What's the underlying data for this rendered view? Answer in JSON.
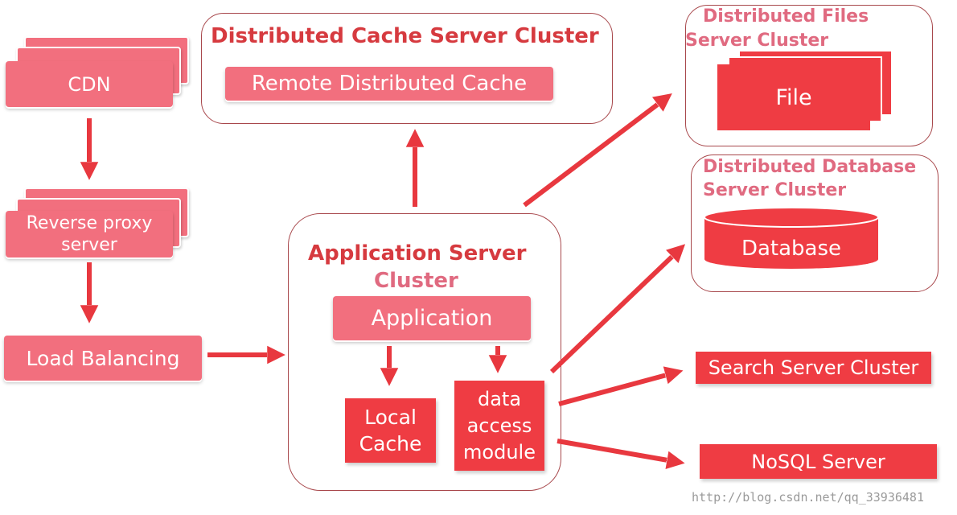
{
  "nodes": {
    "cdn": "CDN",
    "reverse_proxy": "Reverse proxy server",
    "load_balancing": "Load Balancing",
    "cache_cluster_title": "Distributed Cache Server Cluster",
    "remote_cache": "Remote Distributed Cache",
    "app_cluster_title_line1": "Application Server",
    "app_cluster_title_line2": "Cluster",
    "application": "Application",
    "local_cache": "Local Cache",
    "data_access": "data access module",
    "files_cluster_title_line1": "Distributed Files",
    "files_cluster_title_line2": "Server Cluster",
    "file": "File",
    "db_cluster_title_line1": "Distributed Database",
    "db_cluster_title_line2": "Server Cluster",
    "database": "Database",
    "search": "Search Server Cluster",
    "nosql": "NoSQL Server"
  },
  "watermark": "http://blog.csdn.net/qq_33936481",
  "colors": {
    "pink": "#f26f7e",
    "red": "#ef3c43",
    "title": "#d63a3f",
    "pink_title": "#e06a80",
    "arrow": "#e8383f"
  }
}
